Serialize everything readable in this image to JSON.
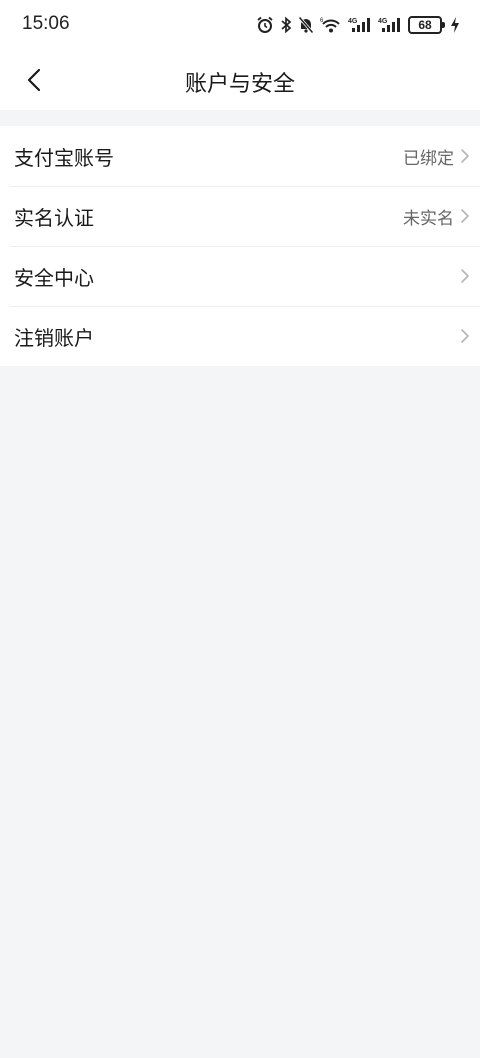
{
  "status_bar": {
    "time": "15:06",
    "battery": "68",
    "icons": [
      "alarm-icon",
      "bluetooth-icon",
      "mute-icon",
      "wifi-icon",
      "signal-4g-icon",
      "signal-4g-icon",
      "battery-icon",
      "charging-icon"
    ]
  },
  "nav": {
    "title": "账户与安全",
    "back_icon": "chevron-left-icon"
  },
  "items": [
    {
      "label": "支付宝账号",
      "value": "已绑定"
    },
    {
      "label": "实名认证",
      "value": "未实名"
    },
    {
      "label": "安全中心",
      "value": ""
    },
    {
      "label": "注销账户",
      "value": ""
    }
  ],
  "colors": {
    "background": "#f4f5f7",
    "surface": "#ffffff",
    "text_primary": "#1a1a1a",
    "text_secondary": "#666666",
    "divider": "#eeeeee",
    "chevron": "#b5b5b5"
  }
}
